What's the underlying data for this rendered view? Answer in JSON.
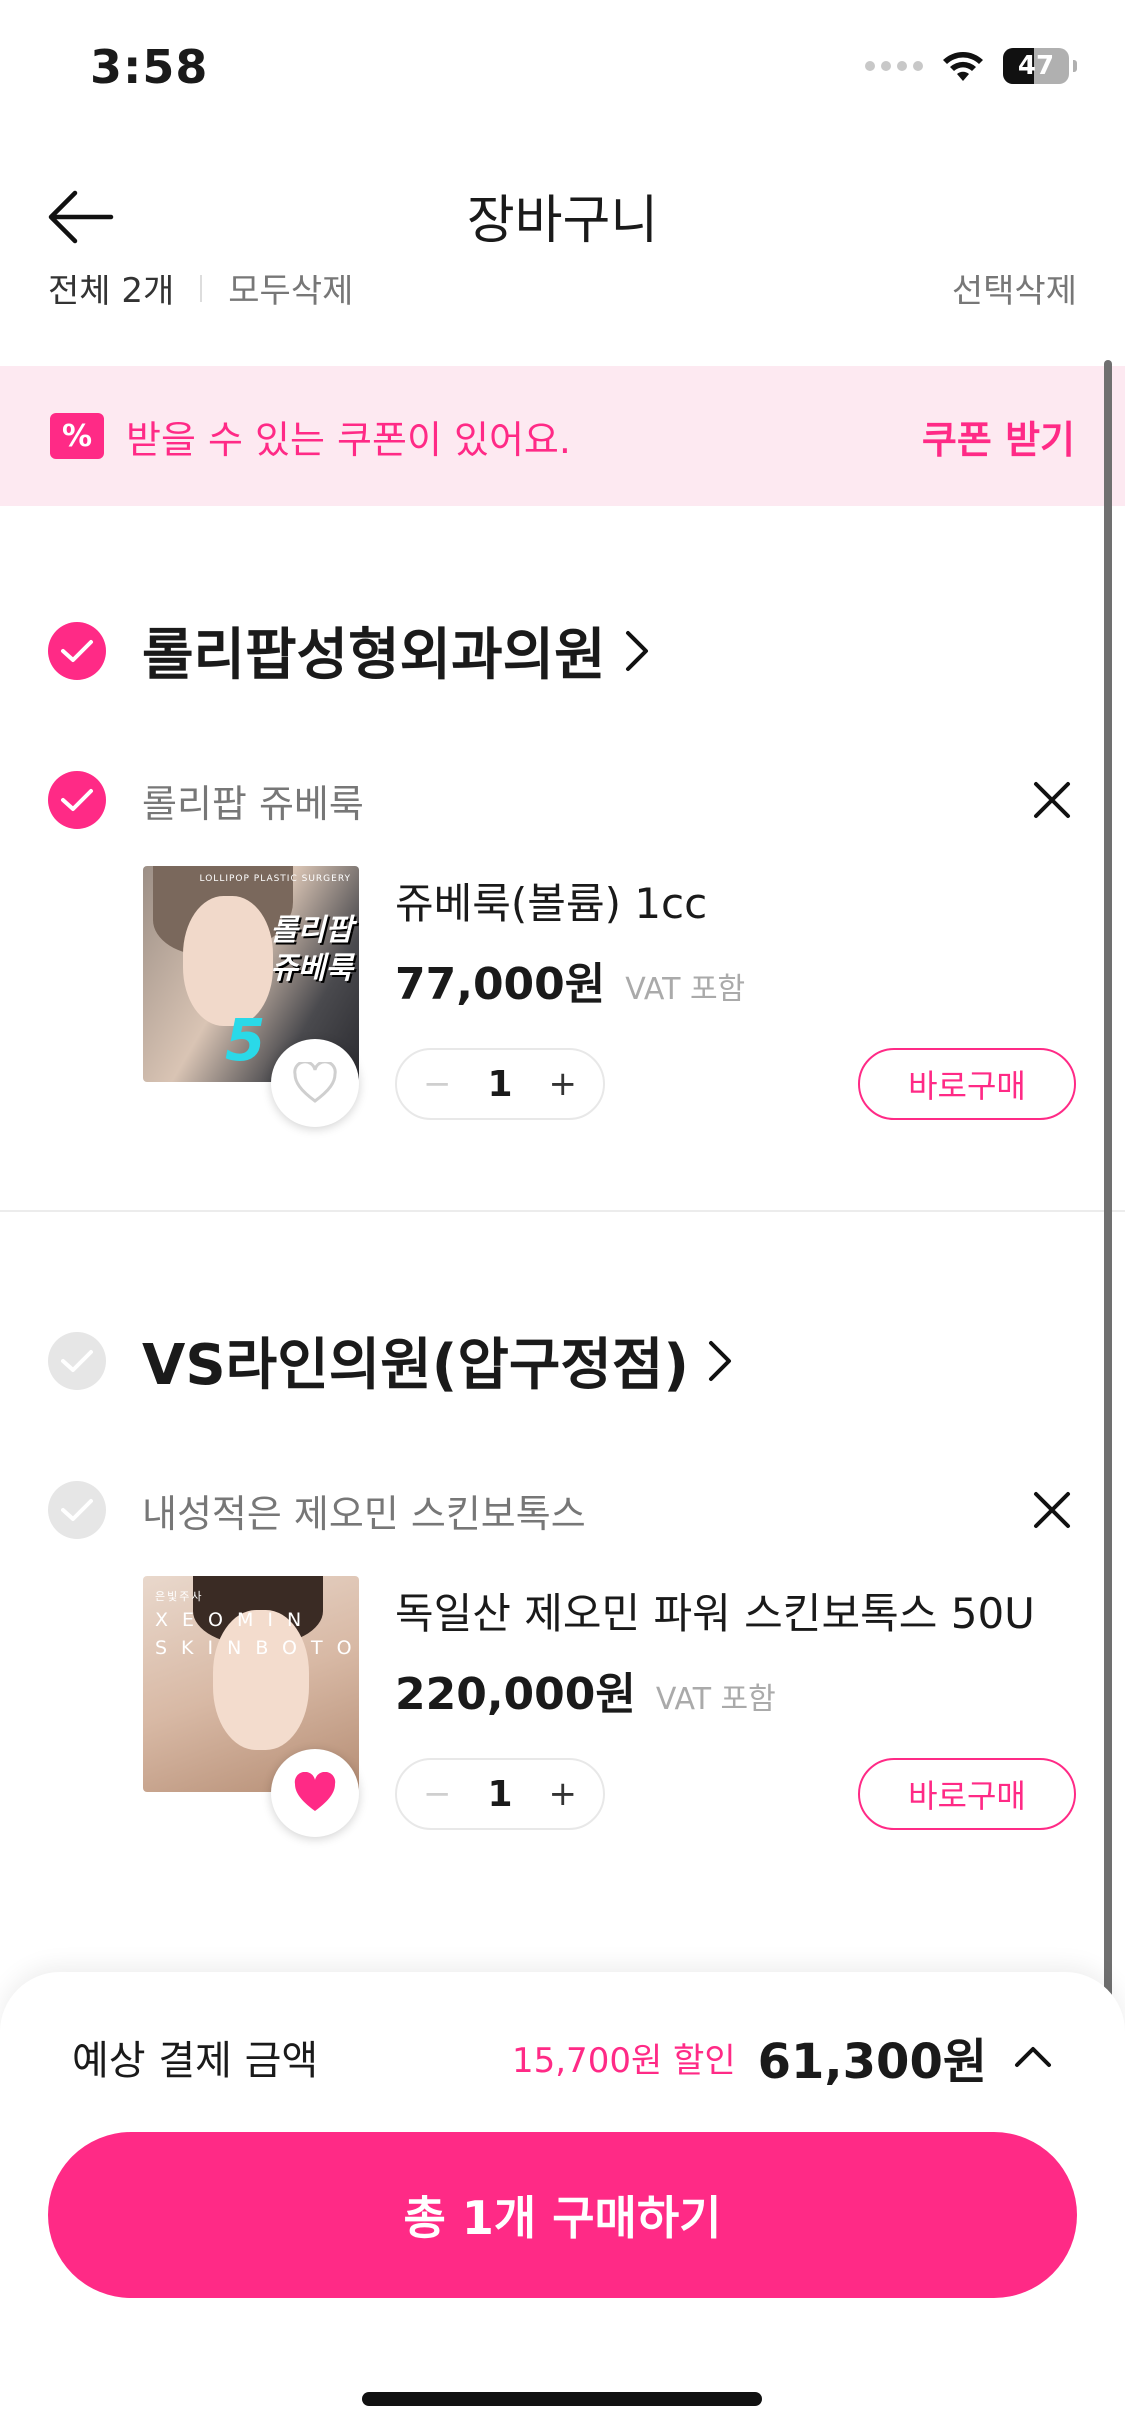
{
  "status_bar": {
    "time": "3:58",
    "battery": "47"
  },
  "header": {
    "title": "장바구니"
  },
  "select_bar": {
    "all_label": "전체 2개",
    "delete_sold_out": "모두삭제",
    "delete_selected": "선택삭제"
  },
  "coupon": {
    "icon": "percent-coupon-icon",
    "text": "받을 수 있는 쿠폰이 있어요.",
    "action": "쿠폰 받기"
  },
  "clinics": [
    {
      "name": "롤리팝성형외과의원",
      "checked": true,
      "product": {
        "brand": "롤리팝 쥬베룩",
        "name": "쥬베룩(볼륨) 1cc",
        "price": "77,000원",
        "vat": "VAT 포함",
        "quantity": "1",
        "buy_label": "바로구매",
        "thumb_tag": "LOLLIPOP PLASTIC SURGERY",
        "thumb_title_1": "롤리팝",
        "thumb_title_2": "쥬베룩",
        "thumb_number": "5",
        "wishlisted": false
      }
    },
    {
      "name": "VS라인의원(압구정점)",
      "checked": false,
      "product": {
        "brand": "내성적은 제오민 스킨보톡스",
        "name": "독일산 제오민 파워 스킨보톡스 50U",
        "price": "220,000원",
        "vat": "VAT 포함",
        "quantity": "1",
        "buy_label": "바로구매",
        "thumb_tag": "은빛주사",
        "thumb_title": "XEOMIN SKINBOTOX",
        "wishlisted": true
      }
    }
  ],
  "summary": {
    "label": "예상 결제 금액",
    "discount": "15,700원 할인",
    "total": "61,300원",
    "purchase_label": "총 1개 구매하기"
  },
  "colors": {
    "accent": "#ff2a86",
    "accent_bg": "#fde9f1",
    "unchecked": "#e6e6e6"
  }
}
